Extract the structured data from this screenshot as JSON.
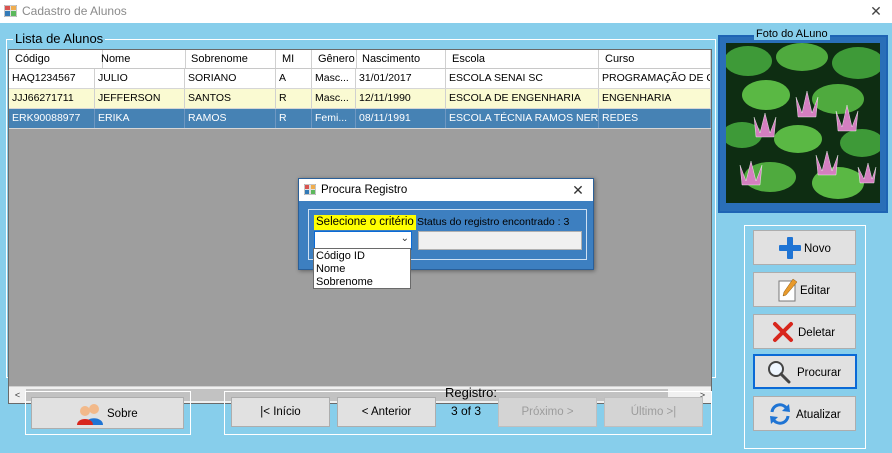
{
  "window": {
    "title": "Cadastro de Alunos",
    "close_glyph": "✕"
  },
  "list_group": {
    "label": "Lista de Alunos"
  },
  "grid": {
    "columns": [
      "Código",
      "Nome",
      "Sobrenome",
      "MI",
      "Gênero",
      "Nascimento",
      "Escola",
      "Curso"
    ],
    "rows": [
      [
        "HAQ1234567",
        "JULIO",
        "SORIANO",
        "A",
        "Masc...",
        "31/01/2017",
        "ESCOLA SENAI SC",
        "PROGRAMAÇÃO DE COM"
      ],
      [
        "JJJ66271711",
        "JEFFERSON",
        "SANTOS",
        "R",
        "Masc...",
        "12/11/1990",
        "ESCOLA DE ENGENHARIA",
        "ENGENHARIA"
      ],
      [
        "ERK90088977",
        "ERIKA",
        "RAMOS",
        "R",
        "Femi...",
        "08/11/1991",
        "ESCOLA TÉCNIA RAMOS NERU...",
        "REDES"
      ]
    ],
    "selected_row": 2
  },
  "photo": {
    "label": "Foto do ALuno"
  },
  "buttons": {
    "novo": "Novo",
    "editar": "Editar",
    "deletar": "Deletar",
    "procurar": "Procurar",
    "atualizar": "Atualizar",
    "sobre": "Sobre"
  },
  "navigation": {
    "registro_label": "Registro:",
    "registro_value": "3 of 3",
    "inicio": "|< Início",
    "anterior": "< Anterior",
    "proximo": "Próximo >",
    "ultimo": "Último >|"
  },
  "dialog": {
    "title": "Procura Registro",
    "criterio_label": "Selecione o critério",
    "status_label": "Status do registro encontrado : 3",
    "selected_value": "",
    "status_value": "",
    "options": [
      "Código ID",
      "Nome",
      "Sobrenome"
    ]
  },
  "colors": {
    "background": "#87ceeb",
    "grid_bg": "#9e9e9e",
    "row_white": "#ffffff",
    "row_alt": "#fafad2",
    "row_selected": "#4682b4",
    "dialog_bg": "#3d7fc0",
    "highlight_yellow": "#ffff00"
  }
}
